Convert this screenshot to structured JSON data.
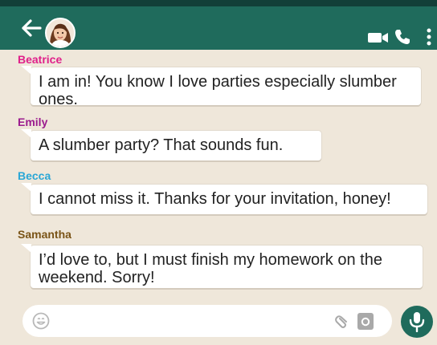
{
  "header": {
    "back_icon": "arrow-left-icon",
    "avatar_icon": "user-avatar",
    "actions": [
      "video-camera-icon",
      "phone-icon",
      "more-vertical-icon"
    ]
  },
  "messages": [
    {
      "sender": "Beatrice",
      "sender_color": "#e0208a",
      "text": "I am in! You know I love parties especially slumber ones."
    },
    {
      "sender": "Emily",
      "sender_color": "#9b1b8e",
      "text": "A slumber party? That sounds fun."
    },
    {
      "sender": "Becca",
      "sender_color": "#2aa7d6",
      "text": "I cannot miss it. Thanks for your invitation, honey!"
    },
    {
      "sender": "Samantha",
      "sender_color": "#7a5417",
      "text": "I’d love to, but I must finish my homework on the weekend. Sorry!"
    }
  ],
  "input": {
    "placeholder": "",
    "icons": [
      "emoji-icon",
      "attachment-icon",
      "camera-icon"
    ]
  },
  "colors": {
    "header": "#1f6b5c",
    "background": "#efe7da",
    "mic_button": "#1f6b5c"
  }
}
